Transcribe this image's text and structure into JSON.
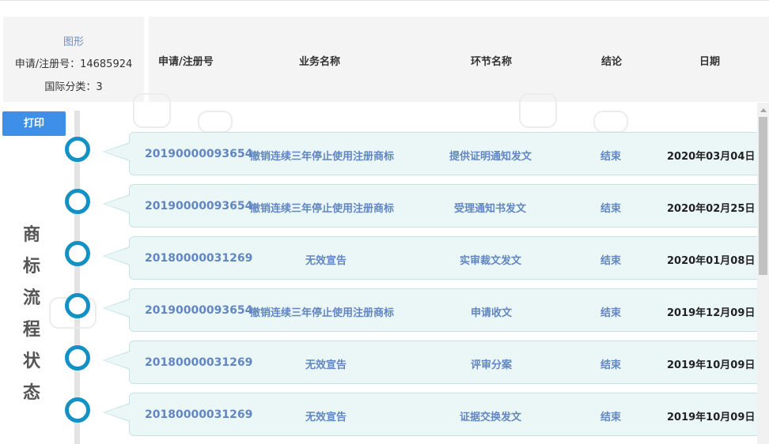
{
  "info": {
    "shape_link": "图形",
    "reg_no_label": "申请/注册号：14685924",
    "class_label": "国际分类：3"
  },
  "header": {
    "col_regno": "申请/注册号",
    "col_business": "业务名称",
    "col_step": "环节名称",
    "col_result": "结论",
    "col_date": "日期"
  },
  "print_label": "打印",
  "side_title": [
    "商",
    "标",
    "流",
    "程",
    "状",
    "态"
  ],
  "rows": [
    {
      "regno": "20190000093654",
      "business": "撤销连续三年停止使用注册商标",
      "step": "提供证明通知发文",
      "result": "结束",
      "date": "2020年03月04日"
    },
    {
      "regno": "20190000093654",
      "business": "撤销连续三年停止使用注册商标",
      "step": "受理通知书发文",
      "result": "结束",
      "date": "2020年02月25日"
    },
    {
      "regno": "20180000031269",
      "business": "无效宣告",
      "step": "实审裁文发文",
      "result": "结束",
      "date": "2020年01月08日"
    },
    {
      "regno": "20190000093654",
      "business": "撤销连续三年停止使用注册商标",
      "step": "申请收文",
      "result": "结束",
      "date": "2019年12月09日"
    },
    {
      "regno": "20180000031269",
      "business": "无效宣告",
      "step": "评审分案",
      "result": "结束",
      "date": "2019年10月09日"
    },
    {
      "regno": "20180000031269",
      "business": "无效宣告",
      "step": "证据交换发文",
      "result": "结束",
      "date": "2019年10月09日"
    }
  ],
  "colors": {
    "accent_blue": "#3d8fe8",
    "timeline_dot": "#1491c4",
    "row_bg": "#ebf7f7",
    "row_text": "#6286c1"
  }
}
